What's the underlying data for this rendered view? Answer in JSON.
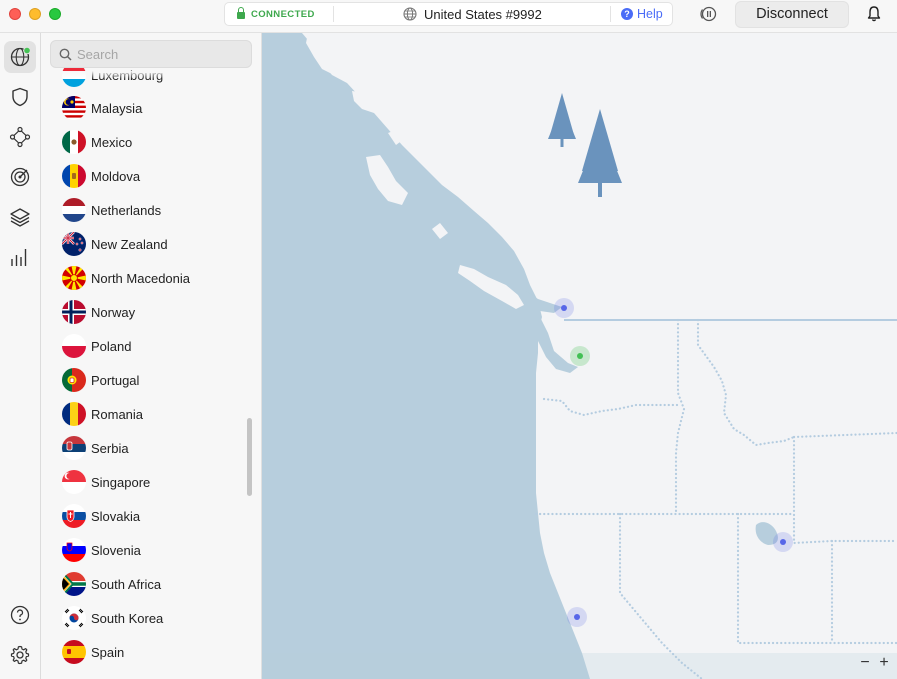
{
  "titlebar": {
    "status": "CONNECTED",
    "server": "United States #9992",
    "help": "Help",
    "disconnect": "Disconnect"
  },
  "rail": {
    "items": [
      {
        "icon": "globe-icon",
        "active": true
      },
      {
        "icon": "shield-icon",
        "active": false
      },
      {
        "icon": "meshnet-icon",
        "active": false
      },
      {
        "icon": "target-icon",
        "active": false
      },
      {
        "icon": "layers-icon",
        "active": false
      },
      {
        "icon": "stats-icon",
        "active": false
      }
    ],
    "bottom": [
      {
        "icon": "help-icon"
      },
      {
        "icon": "settings-icon"
      }
    ]
  },
  "search": {
    "placeholder": "Search",
    "value": ""
  },
  "countries": [
    {
      "name": "Luxembourg",
      "flag": "luxembourg"
    },
    {
      "name": "Malaysia",
      "flag": "malaysia"
    },
    {
      "name": "Mexico",
      "flag": "mexico"
    },
    {
      "name": "Moldova",
      "flag": "moldova"
    },
    {
      "name": "Netherlands",
      "flag": "netherlands"
    },
    {
      "name": "New Zealand",
      "flag": "new-zealand"
    },
    {
      "name": "North Macedonia",
      "flag": "north-macedonia"
    },
    {
      "name": "Norway",
      "flag": "norway"
    },
    {
      "name": "Poland",
      "flag": "poland"
    },
    {
      "name": "Portugal",
      "flag": "portugal"
    },
    {
      "name": "Romania",
      "flag": "romania"
    },
    {
      "name": "Serbia",
      "flag": "serbia"
    },
    {
      "name": "Singapore",
      "flag": "singapore"
    },
    {
      "name": "Slovakia",
      "flag": "slovakia"
    },
    {
      "name": "Slovenia",
      "flag": "slovenia"
    },
    {
      "name": "South Africa",
      "flag": "south-africa"
    },
    {
      "name": "South Korea",
      "flag": "south-korea"
    },
    {
      "name": "Spain",
      "flag": "spain"
    }
  ],
  "map": {
    "zoom_out": "−",
    "zoom_in": "+",
    "colors": {
      "water": "#b7cedd",
      "land": "#f3f4f6",
      "border": "#b4cce0",
      "tree": "#6a93bd",
      "server_pin": "#5867e8",
      "connected_pin": "#43c055"
    }
  }
}
